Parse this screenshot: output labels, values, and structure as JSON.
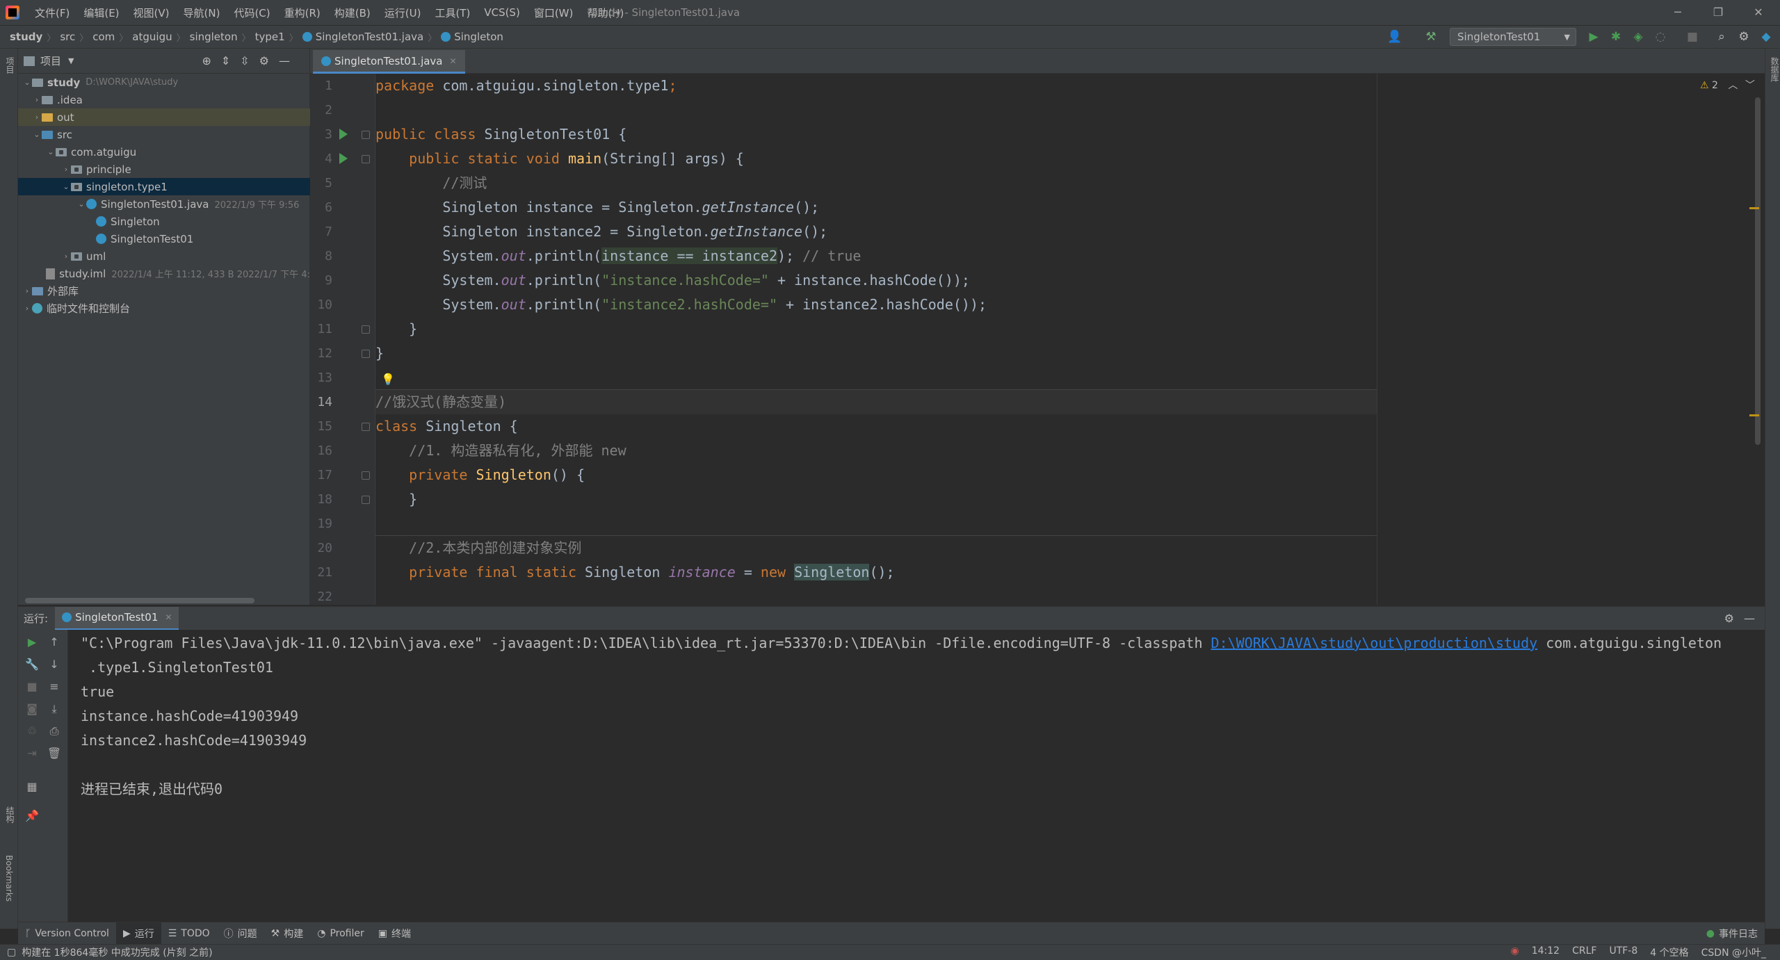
{
  "window": {
    "title": "study - SingletonTest01.java"
  },
  "menu": [
    "文件(F)",
    "编辑(E)",
    "视图(V)",
    "导航(N)",
    "代码(C)",
    "重构(R)",
    "构建(B)",
    "运行(U)",
    "工具(T)",
    "VCS(S)",
    "窗口(W)",
    "帮助(H)"
  ],
  "breadcrumb": [
    "study",
    "src",
    "com",
    "atguigu",
    "singleton",
    "type1",
    "SingletonTest01.java",
    "Singleton"
  ],
  "toolbar": {
    "run_config": "SingletonTest01"
  },
  "project": {
    "header": "项目",
    "rows": [
      {
        "label": "study",
        "meta": "D:\\WORK\\JAVA\\study"
      },
      {
        "label": ".idea"
      },
      {
        "label": "out"
      },
      {
        "label": "src"
      },
      {
        "label": "com.atguigu"
      },
      {
        "label": "principle"
      },
      {
        "label": "singleton.type1"
      },
      {
        "label": "SingletonTest01.java",
        "meta": "2022/1/9 下午 9:56"
      },
      {
        "label": "Singleton"
      },
      {
        "label": "SingletonTest01"
      },
      {
        "label": "uml"
      },
      {
        "label": "study.iml",
        "meta": "2022/1/4 上午 11:12, 433 B 2022/1/7 下午 4:"
      },
      {
        "label": "外部库"
      },
      {
        "label": "临时文件和控制台"
      }
    ]
  },
  "editor": {
    "tab": "SingletonTest01.java",
    "warnings": "2",
    "line_numbers": [
      "1",
      "2",
      "3",
      "4",
      "5",
      "6",
      "7",
      "8",
      "9",
      "10",
      "11",
      "12",
      "13",
      "14",
      "15",
      "16",
      "17",
      "18",
      "19",
      "20",
      "21",
      "22"
    ],
    "current_line": "14",
    "lines": {
      "l1a": "package ",
      "l1b": "com.atguigu.singleton.type1",
      ";": ";",
      "l3a": "public class ",
      "l3b": "SingletonTest01 {",
      "l4a": "    public static void ",
      "l4b": "main",
      "l4c": "(String[] args) {",
      "l5": "        //测试",
      "l6a": "        Singleton instance = Singleton.",
      "l6b": "getInstance",
      "l6c": "();",
      "l7a": "        Singleton instance2 = Singleton.",
      "l7b": "getInstance",
      "l7c": "();",
      "l8a": "        System.",
      "l8b": "out",
      ".println(": ".println(",
      "l8c": "instance == instance2",
      ");": ");",
      "l8d": " // true",
      "l9a": "        System.",
      "l9b": "out",
      "l9c": ".println(",
      "l9d": "\"instance.hashCode=\"",
      "l9e": " + instance.hashCode());",
      "l10a": "        System.",
      "l10b": "out",
      "l10c": ".println(",
      "l10d": "\"instance2.hashCode=\"",
      "l10e": " + instance2.hashCode());",
      "l11": "    }",
      "l12": "}",
      "l14": "//饿汉式(静态变量)",
      "l15a": "class ",
      "l15b": "Singleton {",
      "l16": "    //1. 构造器私有化, 外部能 new",
      "l17a": "    private ",
      "l17b": "Singleton",
      "l17c": "() {",
      "l18": "    }",
      "l20": "    //2.本类内部创建对象实例",
      "l21a": "    private final static ",
      "l21b": "Singleton ",
      "l21c": "instance",
      " = ": " = ",
      "l21d": "new ",
      "l21e": "Singleton",
      "l21f": "();"
    }
  },
  "run": {
    "label": "运行:",
    "tab": "SingletonTest01",
    "cmd_a": "\"C:\\Program Files\\Java\\jdk-11.0.12\\bin\\java.exe\" -javaagent:D:\\IDEA\\lib\\idea_rt.jar=53370:D:\\IDEA\\bin -Dfile.encoding=UTF-8 -classpath ",
    "cmd_link": "D:\\WORK\\JAVA\\study\\out\\production\\study",
    "cmd_b": " com.atguigu.singleton",
    "cmd_c": " .type1.SingletonTest01",
    "out1": "true",
    "out2": "instance.hashCode=41903949",
    "out3": "instance2.hashCode=41903949",
    "exit": "进程已结束,退出代码0"
  },
  "toolwindows": [
    "Version Control",
    "运行",
    "TODO",
    "问题",
    "构建",
    "Profiler",
    "终端"
  ],
  "event_log": "事件日志",
  "status": {
    "message": "构建在 1秒864毫秒 中成功完成 (片刻 之前)",
    "position": "14:12",
    "line_sep": "CRLF",
    "encoding": "UTF-8",
    "indent": "4 个空格",
    "watermark": "CSDN @小叶_"
  },
  "side_labels": {
    "project": "项目",
    "structure": "结构",
    "bookmarks": "Bookmarks",
    "database": "数据库"
  },
  "colors": {
    "keyword": "#cc7832",
    "string": "#6a8759",
    "comment": "#808080",
    "function": "#ffc66d",
    "field": "#9876aa",
    "accent": "#4a88c7"
  }
}
